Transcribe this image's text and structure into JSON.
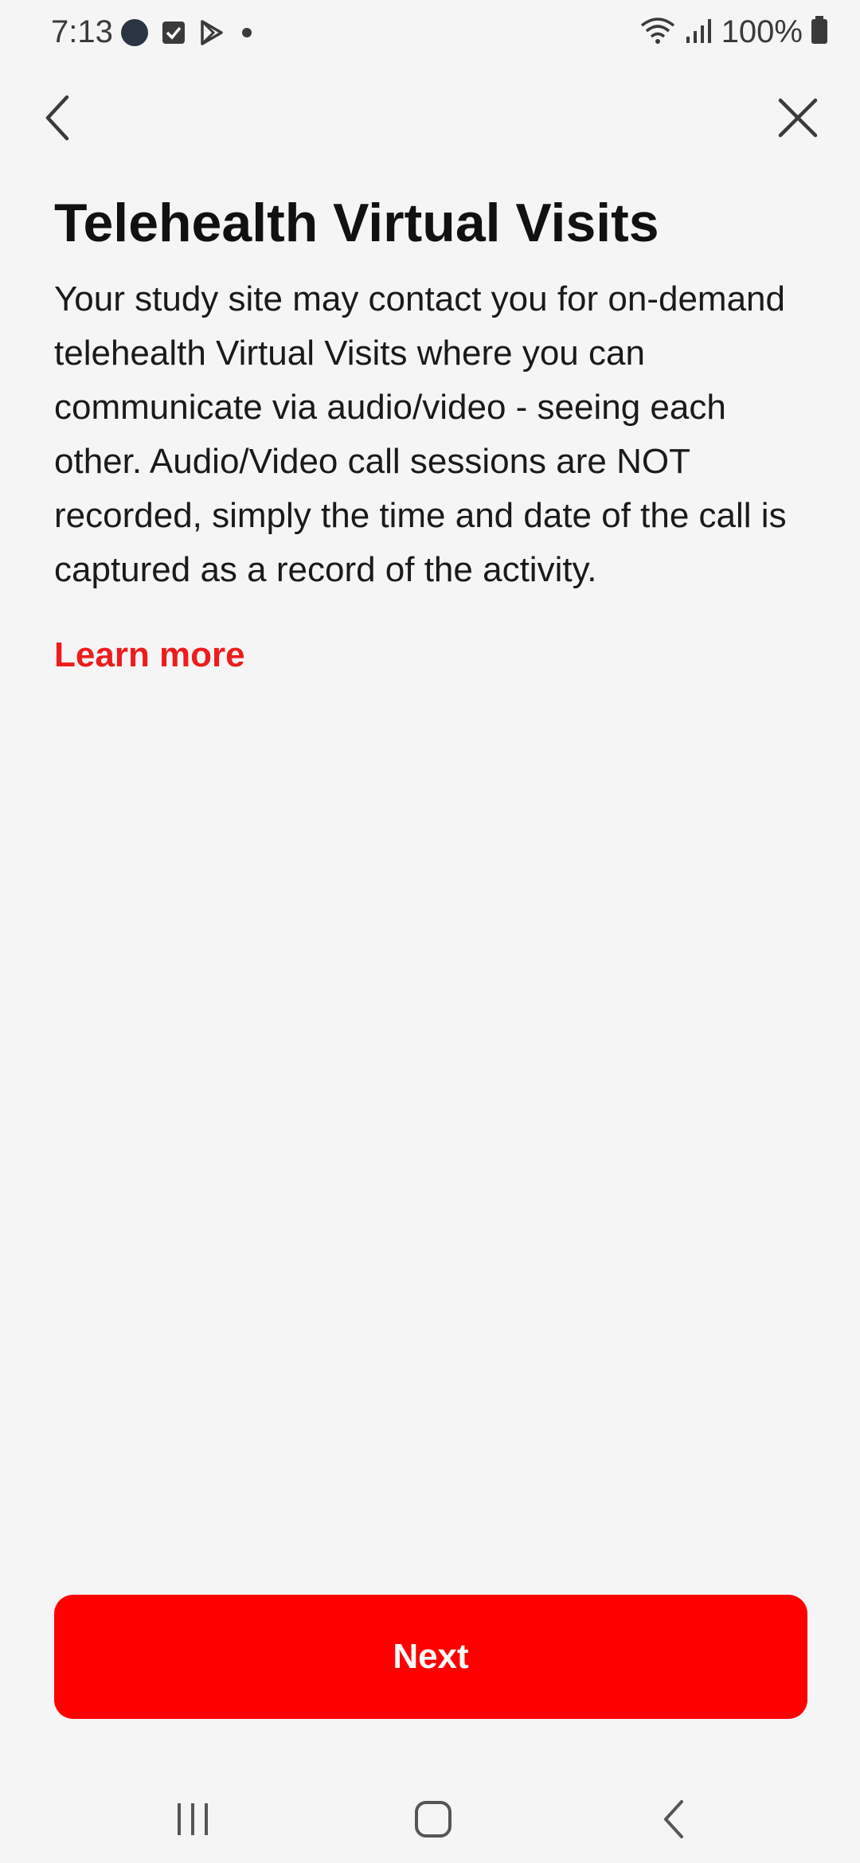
{
  "status_bar": {
    "time": "7:13",
    "battery": "100%",
    "icons": [
      "app-circle-icon",
      "checkbox-icon",
      "play-store-icon",
      "dot-icon",
      "wifi-icon",
      "signal-icon",
      "battery-icon"
    ]
  },
  "header": {
    "back_icon": "chevron-left-icon",
    "close_icon": "close-icon"
  },
  "content": {
    "title": "Telehealth Virtual Visits",
    "body": "Your study site may contact you for on-demand telehealth Virtual Visits where you can communicate via audio/video - seeing each other.  Audio/Video call sessions are NOT recorded, simply the time and date of the call is captured as a record of the activity.",
    "learn_more": "Learn more"
  },
  "actions": {
    "next_label": "Next"
  },
  "system_nav": {
    "icons": [
      "recent-apps-icon",
      "home-icon",
      "back-icon"
    ]
  },
  "colors": {
    "accent": "#ff0000",
    "link": "#ee1c1c",
    "background": "#f5f5f6"
  }
}
